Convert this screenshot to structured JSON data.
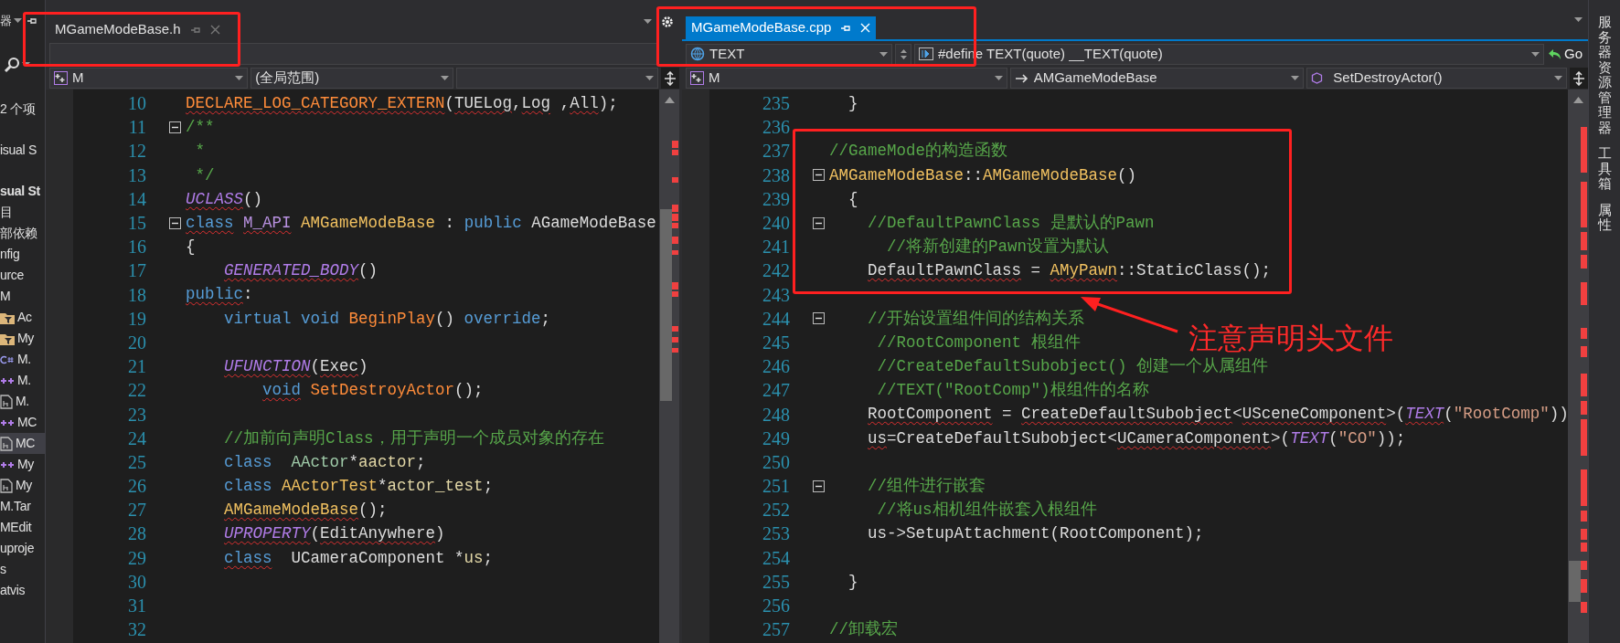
{
  "solution_strip": {
    "header": "器",
    "items": [
      {
        "text": "2 个项",
        "kind": "text",
        "selected": false
      },
      {
        "text": "isual S",
        "kind": "text",
        "selected": false
      },
      {
        "text": "sual St",
        "kind": "bold",
        "selected": false
      },
      {
        "text": "目",
        "kind": "text",
        "selected": false
      },
      {
        "text": "部依赖",
        "kind": "text",
        "selected": false
      },
      {
        "text": "nfig",
        "kind": "text",
        "selected": false
      },
      {
        "text": "urce",
        "kind": "text",
        "selected": false
      },
      {
        "text": "M",
        "kind": "text",
        "selected": false
      },
      {
        "text": "Ac",
        "kind": "filter",
        "selected": false
      },
      {
        "text": "My",
        "kind": "filter",
        "selected": false
      },
      {
        "text": "M.",
        "kind": "csharp",
        "selected": false
      },
      {
        "text": "M.",
        "kind": "cpp",
        "selected": false
      },
      {
        "text": "M.",
        "kind": "header",
        "selected": false
      },
      {
        "text": "MC",
        "kind": "cpp",
        "selected": false
      },
      {
        "text": "MC",
        "kind": "header",
        "selected": true
      },
      {
        "text": "My",
        "kind": "cpp",
        "selected": false
      },
      {
        "text": "My",
        "kind": "header",
        "selected": false
      },
      {
        "text": "M.Tar",
        "kind": "text",
        "selected": false
      },
      {
        "text": "MEdit",
        "kind": "text",
        "selected": false
      },
      {
        "text": "uproje",
        "kind": "text",
        "selected": false
      },
      {
        "text": "s",
        "kind": "text",
        "selected": false
      },
      {
        "text": "atvis",
        "kind": "text",
        "selected": false
      }
    ]
  },
  "editors": [
    {
      "tab": {
        "label": "MGameModeBase.h",
        "selected": false
      },
      "nav_bottom": [
        {
          "label": "M",
          "kind": "project"
        },
        {
          "label": "(全局范围)",
          "kind": "plain"
        },
        {
          "kind": "plain"
        }
      ],
      "lines": [
        {
          "number": "10",
          "fold": false,
          "tokens": [
            {
              "text": "DECLARE_LOG_CATEGORY_EXTERN",
              "kind": "fn",
              "error": true
            },
            {
              "text": "(",
              "kind": "txt",
              "error": false
            },
            {
              "text": "TUELog",
              "kind": "txt",
              "error": true
            },
            {
              "text": ",",
              "kind": "txt",
              "error": false
            },
            {
              "text": "Log",
              "kind": "txt",
              "error": true
            },
            {
              "text": " ,",
              "kind": "txt",
              "error": false
            },
            {
              "text": "All",
              "kind": "txt",
              "error": true
            },
            {
              "text": ");",
              "kind": "txt",
              "error": false
            }
          ]
        },
        {
          "number": "11",
          "fold": true,
          "tokens": [
            {
              "text": "/**",
              "kind": "cmt",
              "error": false
            }
          ]
        },
        {
          "number": "12",
          "fold": false,
          "tokens": [
            {
              "text": " *",
              "kind": "cmt",
              "error": false
            }
          ]
        },
        {
          "number": "13",
          "fold": false,
          "tokens": [
            {
              "text": " */",
              "kind": "cmt",
              "error": false
            }
          ]
        },
        {
          "number": "14",
          "fold": false,
          "tokens": [
            {
              "text": "UCLASS",
              "kind": "macro",
              "error": true
            },
            {
              "text": "()",
              "kind": "txt",
              "error": false
            }
          ]
        },
        {
          "number": "15",
          "fold": true,
          "tokens": [
            {
              "text": "class",
              "kind": "kw",
              "error": true
            },
            {
              "text": " M_API",
              "kind": "api",
              "error": true
            },
            {
              "text": " AMGameModeBase",
              "kind": "type",
              "error": false
            },
            {
              "text": " : ",
              "kind": "txt",
              "error": false
            },
            {
              "text": "public",
              "kind": "kw",
              "error": false
            },
            {
              "text": " AGameModeBase",
              "kind": "txt",
              "error": false
            }
          ]
        },
        {
          "number": "16",
          "fold": false,
          "tokens": [
            {
              "text": "{",
              "kind": "txt",
              "error": false
            }
          ]
        },
        {
          "number": "17",
          "fold": false,
          "tokens": [
            {
              "text": "    GENERATED_BODY",
              "kind": "macro",
              "error": true
            },
            {
              "text": "()",
              "kind": "txt",
              "error": false
            }
          ]
        },
        {
          "number": "18",
          "fold": false,
          "tokens": [
            {
              "text": "public",
              "kind": "kw",
              "error": true
            },
            {
              "text": ":",
              "kind": "txt",
              "error": false
            }
          ]
        },
        {
          "number": "19",
          "fold": false,
          "tokens": [
            {
              "text": "    virtual void ",
              "kind": "kw",
              "error": false
            },
            {
              "text": "BeginPlay",
              "kind": "fn",
              "error": false
            },
            {
              "text": "() ",
              "kind": "txt",
              "error": false
            },
            {
              "text": "override",
              "kind": "kw",
              "error": false
            },
            {
              "text": ";",
              "kind": "txt",
              "error": false
            }
          ]
        },
        {
          "number": "20",
          "fold": false
        },
        {
          "number": "21",
          "fold": false,
          "tokens": [
            {
              "text": "    UFUNCTION",
              "kind": "macro",
              "error": true
            },
            {
              "text": "(",
              "kind": "txt",
              "error": false
            },
            {
              "text": "Exec",
              "kind": "txt",
              "error": true
            },
            {
              "text": ")",
              "kind": "txt",
              "error": false
            }
          ]
        },
        {
          "number": "22",
          "fold": false,
          "tokens": [
            {
              "text": "        void",
              "kind": "kw",
              "error": true
            },
            {
              "text": " SetDestroyActor",
              "kind": "fn",
              "error": false
            },
            {
              "text": "();",
              "kind": "txt",
              "error": false
            }
          ]
        },
        {
          "number": "23",
          "fold": false
        },
        {
          "number": "24",
          "fold": false,
          "tokens": [
            {
              "text": "    //加前向声明Class，用于声明一个成员对象的存在",
              "kind": "cmt",
              "error": false
            }
          ]
        },
        {
          "number": "25",
          "fold": false,
          "tokens": [
            {
              "text": "    class",
              "kind": "kw",
              "error": false
            },
            {
              "text": "  AActor",
              "kind": "type2",
              "error": false
            },
            {
              "text": "*",
              "kind": "txt",
              "error": false
            },
            {
              "text": "aactor",
              "kind": "var",
              "error": false
            },
            {
              "text": ";",
              "kind": "txt",
              "error": false
            }
          ]
        },
        {
          "number": "26",
          "fold": false,
          "tokens": [
            {
              "text": "    class",
              "kind": "kw",
              "error": false
            },
            {
              "text": " AActorTest",
              "kind": "type",
              "error": false
            },
            {
              "text": "*",
              "kind": "txt",
              "error": false
            },
            {
              "text": "actor_test",
              "kind": "var",
              "error": false
            },
            {
              "text": ";",
              "kind": "txt",
              "error": false
            }
          ]
        },
        {
          "number": "27",
          "fold": false,
          "tokens": [
            {
              "text": "    AMGameModeBase",
              "kind": "type",
              "error": true
            },
            {
              "text": "();",
              "kind": "txt",
              "error": false
            }
          ]
        },
        {
          "number": "28",
          "fold": false,
          "tokens": [
            {
              "text": "    UPROPERTY",
              "kind": "macro",
              "error": true
            },
            {
              "text": "(",
              "kind": "txt",
              "error": false
            },
            {
              "text": "EditAnywhere",
              "kind": "txt",
              "error": true
            },
            {
              "text": ")",
              "kind": "txt",
              "error": false
            }
          ]
        },
        {
          "number": "29",
          "fold": false,
          "tokens": [
            {
              "text": "    class",
              "kind": "kw",
              "error": true
            },
            {
              "text": "  UCameraComponent *",
              "kind": "txt",
              "error": false
            },
            {
              "text": "us",
              "kind": "var",
              "error": false
            },
            {
              "text": ";",
              "kind": "txt",
              "error": false
            }
          ]
        },
        {
          "number": "30",
          "fold": false
        },
        {
          "number": "31",
          "fold": false
        },
        {
          "number": "32",
          "fold": false
        }
      ]
    },
    {
      "tab": {
        "label": "MGameModeBase.cpp",
        "selected": true
      },
      "nav_top": [
        {
          "label": "TEXT",
          "kind": "scope"
        },
        {
          "label": "#define TEXT(quote) __TEXT(quote)",
          "kind": "define"
        },
        {
          "label": "Go",
          "kind": "go"
        }
      ],
      "nav_bottom": [
        {
          "label": "M",
          "kind": "project"
        },
        {
          "label": "AMGameModeBase",
          "kind": "class"
        },
        {
          "label": "SetDestroyActor()",
          "kind": "member"
        }
      ],
      "lines": [
        {
          "number": "235",
          "fold": false,
          "tokens": [
            {
              "text": "  }",
              "kind": "txt",
              "error": false
            }
          ]
        },
        {
          "number": "236",
          "fold": false
        },
        {
          "number": "237",
          "fold": false,
          "tokens": [
            {
              "text": "//GameMode的构造函数",
              "kind": "cmt",
              "error": false
            }
          ]
        },
        {
          "number": "238",
          "fold": true,
          "tokens": [
            {
              "text": "AMGameModeBase",
              "kind": "type",
              "error": false
            },
            {
              "text": "::",
              "kind": "txt",
              "error": false
            },
            {
              "text": "AMGameModeBase",
              "kind": "type",
              "error": false
            },
            {
              "text": "()",
              "kind": "txt",
              "error": false
            }
          ]
        },
        {
          "number": "239",
          "fold": false,
          "tokens": [
            {
              "text": "  {",
              "kind": "txt",
              "error": false
            }
          ]
        },
        {
          "number": "240",
          "fold": true,
          "tokens": [
            {
              "text": "    //DefaultPawnClass 是默认的Pawn",
              "kind": "cmt",
              "error": false
            }
          ]
        },
        {
          "number": "241",
          "fold": false,
          "tokens": [
            {
              "text": "      //将新创建的Pawn设置为默认",
              "kind": "cmt",
              "error": false
            }
          ]
        },
        {
          "number": "242",
          "fold": false,
          "tokens": [
            {
              "text": "    DefaultPawnClass",
              "kind": "txt",
              "error": true
            },
            {
              "text": " = ",
              "kind": "txt",
              "error": false
            },
            {
              "text": "AMyPawn",
              "kind": "type",
              "error": true
            },
            {
              "text": "::StaticClass();",
              "kind": "txt",
              "error": false
            }
          ]
        },
        {
          "number": "243",
          "fold": false
        },
        {
          "number": "244",
          "fold": true,
          "tokens": [
            {
              "text": "    //开始设置组件间的结构关系",
              "kind": "cmt",
              "error": false
            }
          ]
        },
        {
          "number": "245",
          "fold": false,
          "tokens": [
            {
              "text": "     //RootComponent 根组件",
              "kind": "cmt",
              "error": false
            }
          ]
        },
        {
          "number": "246",
          "fold": false,
          "tokens": [
            {
              "text": "     //CreateDefaultSubobject() 创建一个从属组件",
              "kind": "cmt",
              "error": false
            }
          ]
        },
        {
          "number": "247",
          "fold": false,
          "tokens": [
            {
              "text": "     //TEXT(\"RootComp\")根组件的名称",
              "kind": "cmt",
              "error": false
            }
          ]
        },
        {
          "number": "248",
          "fold": false,
          "tokens": [
            {
              "text": "    RootComponent",
              "kind": "txt",
              "error": true
            },
            {
              "text": " = ",
              "kind": "txt",
              "error": false
            },
            {
              "text": "CreateDefaultSubobject",
              "kind": "txt",
              "error": true
            },
            {
              "text": "<",
              "kind": "txt",
              "error": false
            },
            {
              "text": "USceneComponent",
              "kind": "txt",
              "error": true
            },
            {
              "text": ">(",
              "kind": "txt",
              "error": false
            },
            {
              "text": "TEXT",
              "kind": "macro",
              "error": true
            },
            {
              "text": "(",
              "kind": "txt",
              "error": false
            },
            {
              "text": "\"RootComp\"",
              "kind": "str",
              "error": false
            },
            {
              "text": "))",
              "kind": "txt",
              "error": false
            }
          ]
        },
        {
          "number": "249",
          "fold": false,
          "tokens": [
            {
              "text": "    us",
              "kind": "txt",
              "error": true
            },
            {
              "text": "=CreateDefaultSubobject<",
              "kind": "txt",
              "error": false
            },
            {
              "text": "UCameraComponent",
              "kind": "txt",
              "error": true
            },
            {
              "text": ">(",
              "kind": "txt",
              "error": false
            },
            {
              "text": "TEXT",
              "kind": "macro",
              "error": false
            },
            {
              "text": "(",
              "kind": "txt",
              "error": false
            },
            {
              "text": "\"CO\"",
              "kind": "str",
              "error": false
            },
            {
              "text": "));",
              "kind": "txt",
              "error": false
            }
          ]
        },
        {
          "number": "250",
          "fold": false
        },
        {
          "number": "251",
          "fold": true,
          "tokens": [
            {
              "text": "    //组件进行嵌套",
              "kind": "cmt",
              "error": false
            }
          ]
        },
        {
          "number": "252",
          "fold": false,
          "tokens": [
            {
              "text": "     //将us相机组件嵌套入根组件",
              "kind": "cmt",
              "error": false
            }
          ]
        },
        {
          "number": "253",
          "fold": false,
          "tokens": [
            {
              "text": "    us->SetupAttachment(RootComponent);",
              "kind": "txt",
              "error": false
            }
          ]
        },
        {
          "number": "254",
          "fold": false
        },
        {
          "number": "255",
          "fold": false,
          "tokens": [
            {
              "text": "  }",
              "kind": "txt",
              "error": false
            }
          ]
        },
        {
          "number": "256",
          "fold": false
        },
        {
          "number": "257",
          "fold": false,
          "tokens": [
            {
              "text": "//卸载宏",
              "kind": "cmt",
              "error": false
            }
          ]
        }
      ]
    }
  ],
  "side_tabs": [
    "服务器资源管理器",
    "工具箱",
    "属性"
  ],
  "annotation": {
    "text": "注意声明头文件"
  }
}
